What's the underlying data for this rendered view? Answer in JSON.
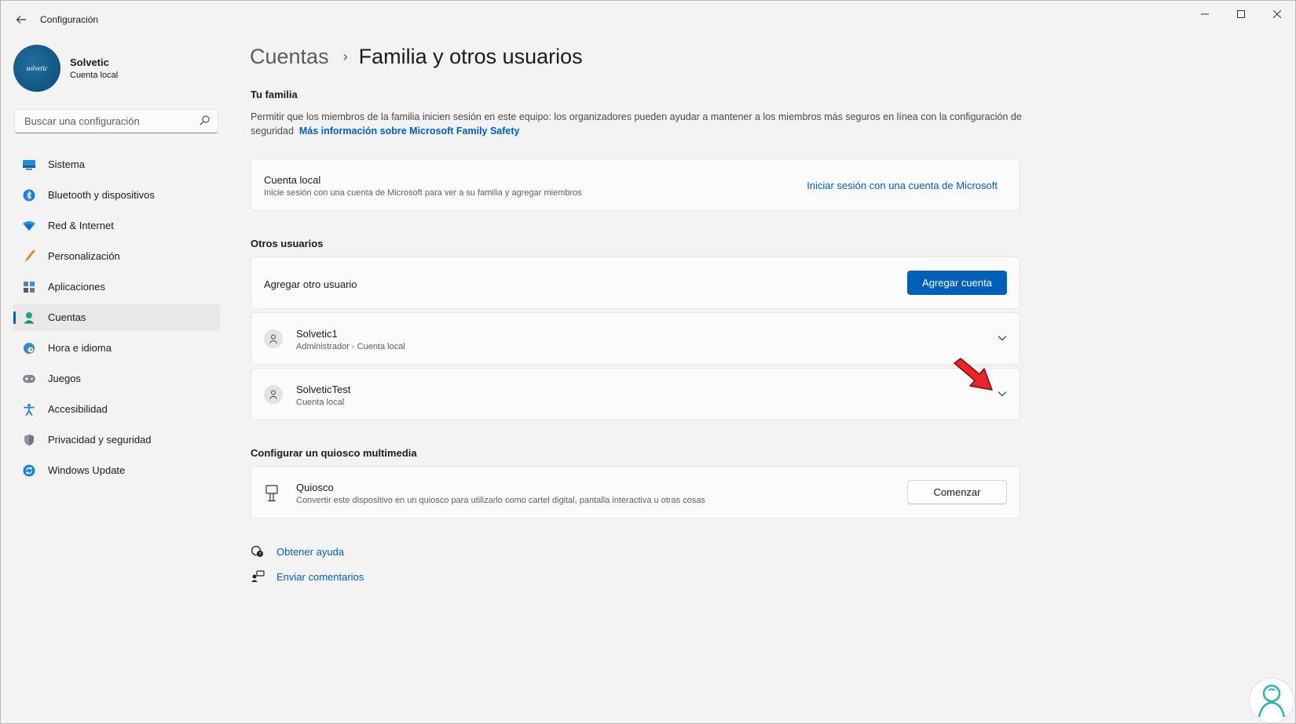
{
  "window": {
    "title": "Configuración"
  },
  "profile": {
    "name": "Solvetic",
    "account_type": "Cuenta local",
    "avatar_text": "solvetic"
  },
  "search": {
    "placeholder": "Buscar una configuración"
  },
  "sidebar": {
    "items": [
      {
        "label": "Sistema",
        "icon": "monitor-icon"
      },
      {
        "label": "Bluetooth y dispositivos",
        "icon": "bluetooth-icon"
      },
      {
        "label": "Red & Internet",
        "icon": "wifi-icon"
      },
      {
        "label": "Personalización",
        "icon": "brush-icon"
      },
      {
        "label": "Aplicaciones",
        "icon": "apps-icon"
      },
      {
        "label": "Cuentas",
        "icon": "person-icon",
        "active": true
      },
      {
        "label": "Hora e idioma",
        "icon": "globe-clock-icon"
      },
      {
        "label": "Juegos",
        "icon": "gamepad-icon"
      },
      {
        "label": "Accesibilidad",
        "icon": "accessibility-icon"
      },
      {
        "label": "Privacidad y seguridad",
        "icon": "shield-icon"
      },
      {
        "label": "Windows Update",
        "icon": "sync-icon"
      }
    ]
  },
  "breadcrumb": {
    "parent": "Cuentas",
    "separator": "›",
    "current": "Familia y otros usuarios"
  },
  "family": {
    "title": "Tu familia",
    "description": "Permitir que los miembros de la familia inicien sesión en este equipo: los organizadores pueden ayudar a mantener a los miembros más seguros en línea con la configuración de seguridad",
    "learn_more": "Más información sobre Microsoft Family Safety",
    "card": {
      "title": "Cuenta local",
      "subtitle": "Inicie sesión con una cuenta de Microsoft para ver a su familia y agregar miembros",
      "action": "Iniciar sesión con una cuenta de Microsoft"
    }
  },
  "others": {
    "title": "Otros usuarios",
    "add_label": "Agregar otro usuario",
    "add_button": "Agregar cuenta",
    "users": [
      {
        "name": "Solvetic1",
        "subtitle": "Administrador - Cuenta local"
      },
      {
        "name": "SolveticTest",
        "subtitle": "Cuenta local"
      }
    ]
  },
  "kiosk": {
    "title": "Configurar un quiosco multimedia",
    "card_title": "Quiosco",
    "card_subtitle": "Convertir este dispositivo en un quiosco para utilizarlo como cartel digital, pantalla interactiva u otras cosas",
    "button": "Comenzar"
  },
  "footer": {
    "help": "Obtener ayuda",
    "feedback": "Enviar comentarios"
  },
  "colors": {
    "accent": "#005fb8",
    "annotation_arrow": "#e8262b"
  }
}
